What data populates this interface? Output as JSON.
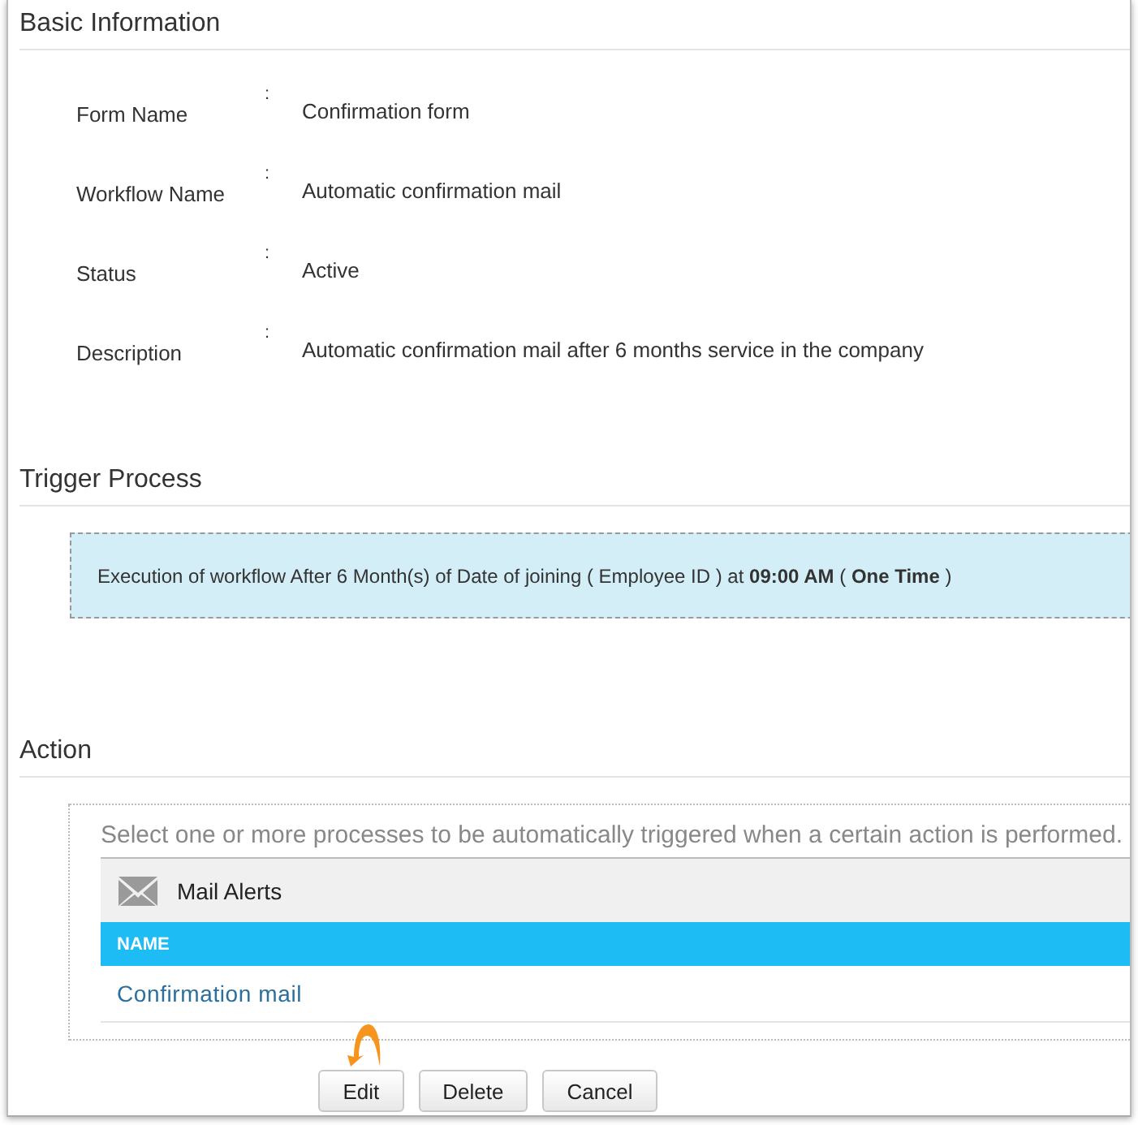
{
  "basic_information": {
    "title": "Basic Information",
    "fields": [
      {
        "label": "Form Name",
        "separator": ":",
        "value": "Confirmation form"
      },
      {
        "label": "Workflow Name",
        "separator": ":",
        "value": "Automatic confirmation mail"
      },
      {
        "label": "Status",
        "separator": ":",
        "value": "Active"
      },
      {
        "label": "Description",
        "separator": ":",
        "value": "Automatic confirmation mail after 6 months service in the company"
      }
    ]
  },
  "trigger_process": {
    "title": "Trigger Process",
    "text": "Execution of workflow After 6 Month(s) of Date of joining ( Employee ID ) at **09:00 AM** ( **One Time** )"
  },
  "action": {
    "title": "Action",
    "hint": "Select one or more processes to be automatically triggered when a certain action is performed.",
    "group": {
      "title": "Mail Alerts",
      "column": "NAME",
      "rows": [
        "Confirmation mail"
      ]
    }
  },
  "buttons": [
    "Edit",
    "Delete",
    "Cancel"
  ]
}
